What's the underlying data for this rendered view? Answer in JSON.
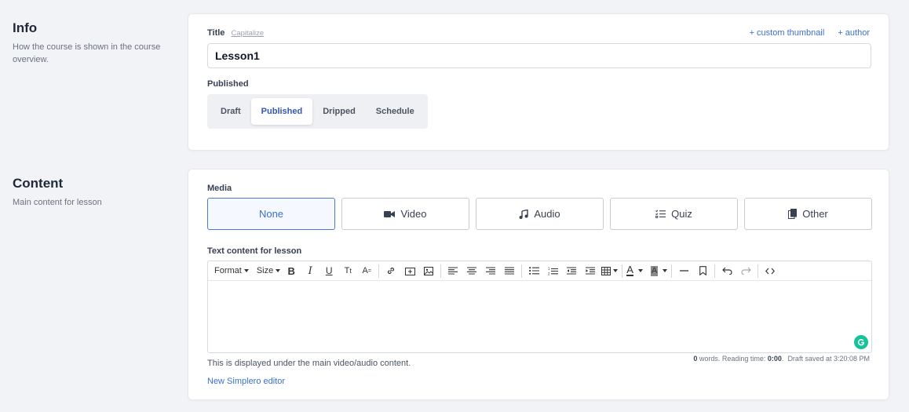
{
  "info": {
    "heading": "Info",
    "description": "How the course is shown in the course overview.",
    "title_label": "Title",
    "capitalize_label": "Capitalize",
    "custom_thumbnail_label": "+ custom thumbnail",
    "author_label": "+ author",
    "title_value": "Lesson1",
    "published_label": "Published",
    "statuses": [
      "Draft",
      "Published",
      "Dripped",
      "Schedule"
    ]
  },
  "content": {
    "heading": "Content",
    "description": "Main content for lesson",
    "media_label": "Media",
    "media_options": [
      "None",
      "Video",
      "Audio",
      "Quiz",
      "Other"
    ],
    "text_label": "Text content for lesson",
    "toolbar": {
      "format": "Format",
      "size": "Size"
    },
    "help_text": "This is displayed under the main video/audio content.",
    "stats": {
      "words": "0",
      "words_label": "words. Reading time:",
      "reading_time": "0:00",
      "draft_saved": "Draft saved at 3:20:08 PM"
    },
    "new_editor_link": "New Simplero editor"
  },
  "colors": {
    "accent": "#3b6fd0",
    "active_status": "#3457b5",
    "grammarly": "#15c39a"
  }
}
